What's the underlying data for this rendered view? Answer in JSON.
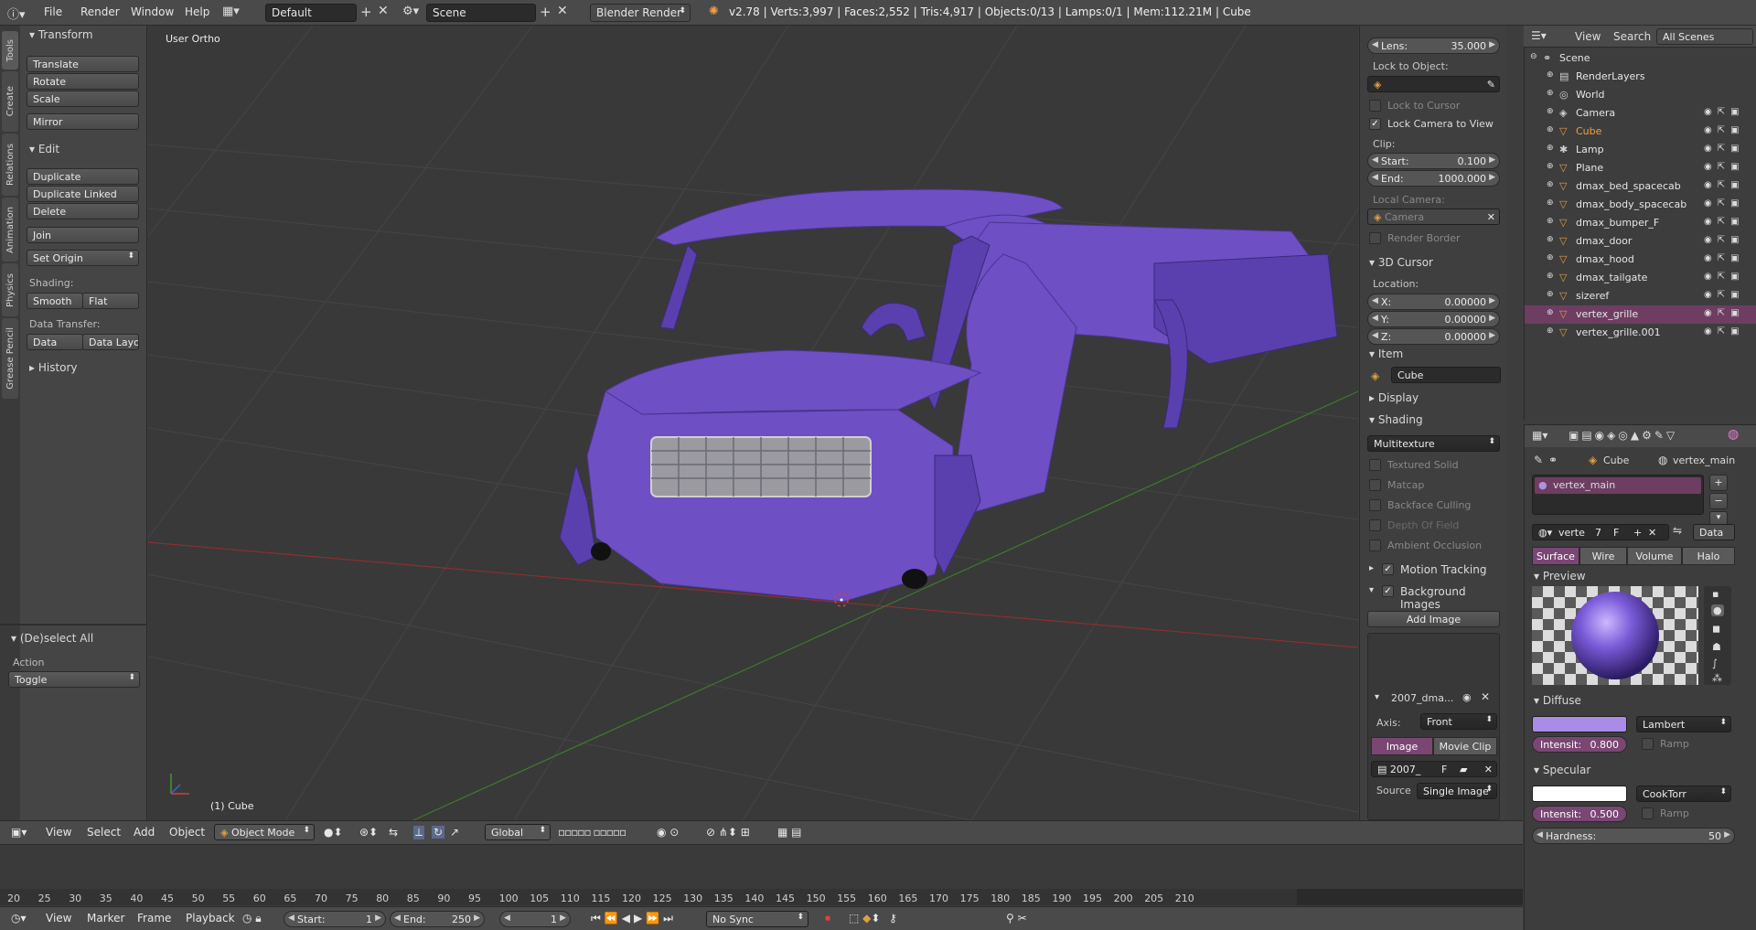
{
  "topbar": {
    "menus": [
      "File",
      "Render",
      "Window",
      "Help"
    ],
    "layout": "Default",
    "scene": "Scene",
    "engine": "Blender Render",
    "stats": "v2.78 | Verts:3,997 | Faces:2,552 | Tris:4,917 | Objects:0/13 | Lamps:0/1 | Mem:112.21M | Cube"
  },
  "toolshelf": {
    "tabs": [
      "Tools",
      "Create",
      "Relations",
      "Animation",
      "Physics",
      "Grease Pencil"
    ],
    "transform_title": "Transform",
    "translate": "Translate",
    "rotate": "Rotate",
    "scale": "Scale",
    "mirror": "Mirror",
    "edit_title": "Edit",
    "duplicate": "Duplicate",
    "duplicate_linked": "Duplicate Linked",
    "delete": "Delete",
    "join": "Join",
    "set_origin": "Set Origin",
    "shading_label": "Shading:",
    "smooth": "Smooth",
    "flat": "Flat",
    "data_transfer_label": "Data Transfer:",
    "data": "Data",
    "data_layout": "Data Layo",
    "history_title": "History",
    "operator_title": "(De)select All",
    "action_label": "Action",
    "action_value": "Toggle"
  },
  "viewport": {
    "view_label": "User Ortho",
    "object_label": "(1) Cube",
    "model_color": "#6e4fc4"
  },
  "npanel": {
    "lens_label": "Lens:",
    "lens_value": "35.000",
    "lock_object_label": "Lock to Object:",
    "lock_cursor": "Lock to Cursor",
    "lock_camera": "Lock Camera to View",
    "clip_label": "Clip:",
    "clip_start_label": "Start:",
    "clip_start": "0.100",
    "clip_end_label": "End:",
    "clip_end": "1000.000",
    "local_camera_label": "Local Camera:",
    "local_camera": "Camera",
    "render_border": "Render Border",
    "cursor_title": "3D Cursor",
    "location_label": "Location:",
    "x_label": "X:",
    "x": "0.00000",
    "y_label": "Y:",
    "y": "0.00000",
    "z_label": "Z:",
    "z": "0.00000",
    "item_title": "Item",
    "item_name": "Cube",
    "display_title": "Display",
    "shading_title": "Shading",
    "shading_mode": "Multitexture",
    "textured_solid": "Textured Solid",
    "matcap": "Matcap",
    "backface": "Backface Culling",
    "dof": "Depth Of Field",
    "ao": "Ambient Occlusion",
    "motion_tracking": "Motion Tracking",
    "bg_images": "Background Images",
    "add_image": "Add Image",
    "bg_name": "2007_dma...",
    "axis_label": "Axis:",
    "axis_value": "Front",
    "image_tab": "Image",
    "movie_tab": "Movie Clip",
    "image_name": "2007_",
    "image_f": "F",
    "source_label": "Source",
    "source_value": "Single Image"
  },
  "outliner": {
    "view": "View",
    "search": "Search",
    "scenes": "All Scenes",
    "items": [
      {
        "name": "Scene",
        "depth": 0,
        "kind": "scene"
      },
      {
        "name": "RenderLayers",
        "depth": 1,
        "kind": "renderlayers"
      },
      {
        "name": "World",
        "depth": 1,
        "kind": "world"
      },
      {
        "name": "Camera",
        "depth": 1,
        "kind": "camera"
      },
      {
        "name": "Cube",
        "depth": 1,
        "kind": "mesh",
        "active": true
      },
      {
        "name": "Lamp",
        "depth": 1,
        "kind": "lamp"
      },
      {
        "name": "Plane",
        "depth": 1,
        "kind": "mesh"
      },
      {
        "name": "dmax_bed_spacecab",
        "depth": 1,
        "kind": "mesh"
      },
      {
        "name": "dmax_body_spacecab",
        "depth": 1,
        "kind": "mesh"
      },
      {
        "name": "dmax_bumper_F",
        "depth": 1,
        "kind": "mesh"
      },
      {
        "name": "dmax_door",
        "depth": 1,
        "kind": "mesh"
      },
      {
        "name": "dmax_hood",
        "depth": 1,
        "kind": "mesh"
      },
      {
        "name": "dmax_tailgate",
        "depth": 1,
        "kind": "mesh"
      },
      {
        "name": "sizeref",
        "depth": 1,
        "kind": "mesh"
      },
      {
        "name": "vertex_grille",
        "depth": 1,
        "kind": "mesh",
        "selected": true
      },
      {
        "name": "vertex_grille.001",
        "depth": 1,
        "kind": "mesh"
      }
    ]
  },
  "props": {
    "breadcrumb_object": "Cube",
    "breadcrumb_material": "vertex_main",
    "material_slot": "vertex_main",
    "mat_name": "verte",
    "mat_users": "7",
    "mat_f": "F",
    "data_link": "Data",
    "tabs": [
      "Surface",
      "Wire",
      "Volume",
      "Halo"
    ],
    "preview_title": "Preview",
    "diffuse_title": "Diffuse",
    "diffuse_color": "#a98ce8",
    "diffuse_shader": "Lambert",
    "diffuse_intensity_label": "Intensit:",
    "diffuse_intensity": "0.800",
    "ramp": "Ramp",
    "specular_title": "Specular",
    "specular_color": "#ffffff",
    "specular_shader": "CookTorr",
    "specular_intensity_label": "Intensit:",
    "specular_intensity": "0.500",
    "hardness_label": "Hardness:",
    "hardness": "50"
  },
  "vp_header": {
    "view": "View",
    "select": "Select",
    "add": "Add",
    "object": "Object",
    "mode": "Object Mode",
    "orientation": "Global"
  },
  "timeline": {
    "ticks": [
      "20",
      "25",
      "30",
      "35",
      "40",
      "45",
      "50",
      "55",
      "60",
      "65",
      "70",
      "75",
      "80",
      "85",
      "90",
      "95",
      "100",
      "105",
      "110",
      "115",
      "120",
      "125",
      "130",
      "135",
      "140",
      "145",
      "150",
      "155",
      "160",
      "165",
      "170",
      "175",
      "180",
      "185",
      "190",
      "195",
      "200",
      "205",
      "210"
    ]
  },
  "tl_header": {
    "view": "View",
    "marker": "Marker",
    "frame": "Frame",
    "playback": "Playback",
    "start_label": "Start:",
    "start": "1",
    "end_label": "End:",
    "end": "250",
    "current": "1",
    "sync": "No Sync"
  }
}
